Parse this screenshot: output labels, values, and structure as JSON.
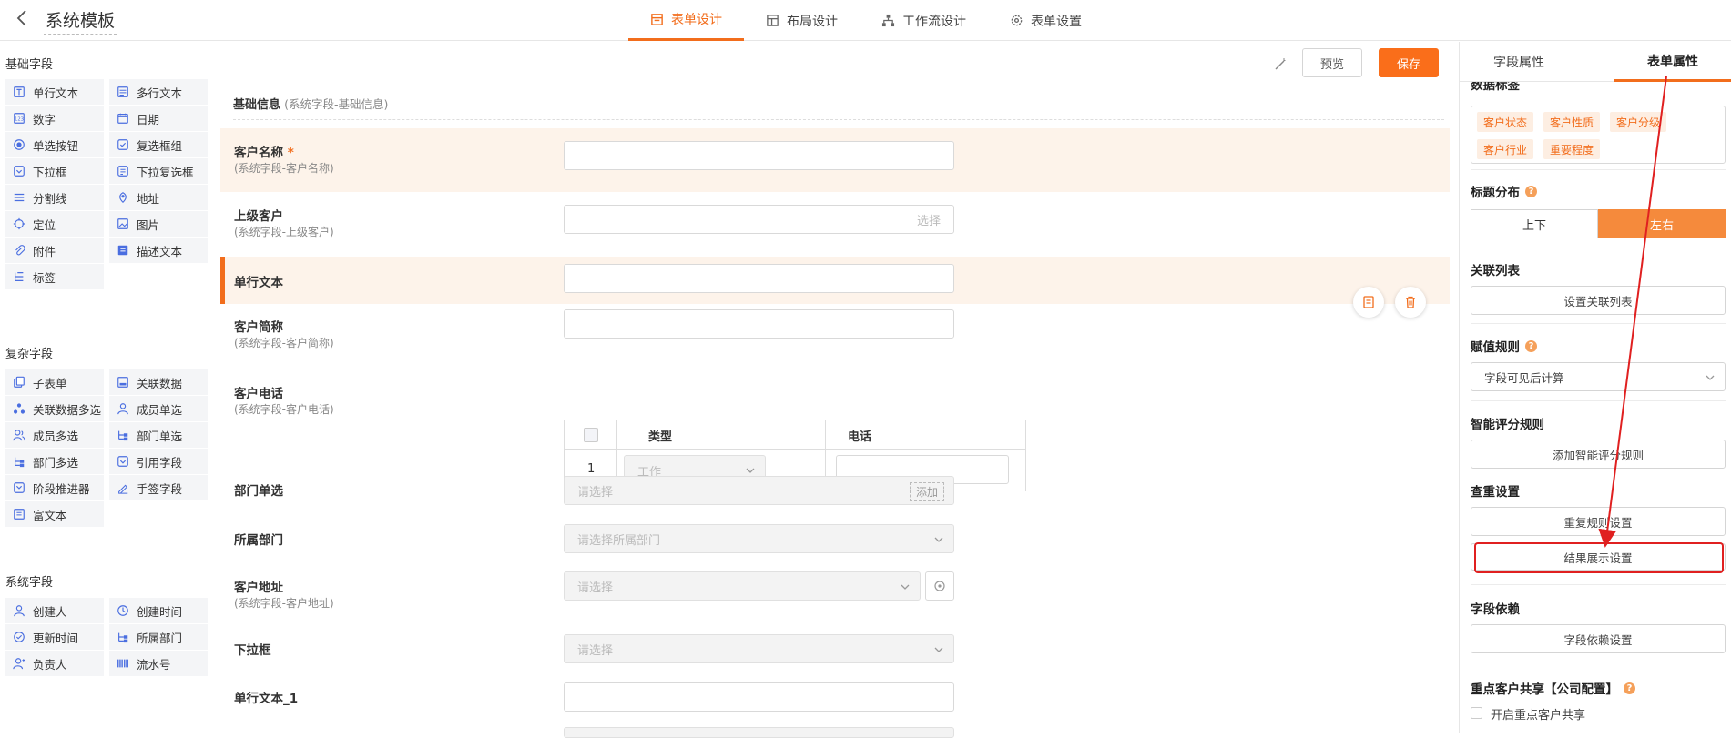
{
  "app": {
    "title": "系统模板"
  },
  "tabs": [
    {
      "label": "表单设计",
      "icon": "form-icon",
      "active": true
    },
    {
      "label": "布局设计",
      "icon": "layout-icon",
      "active": false
    },
    {
      "label": "工作流设计",
      "icon": "workflow-icon",
      "active": false
    },
    {
      "label": "表单设置",
      "icon": "gear-icon",
      "active": false
    }
  ],
  "left": {
    "basic": {
      "title": "基础字段",
      "items": [
        "单行文本",
        "多行文本",
        "数字",
        "日期",
        "单选按钮",
        "复选框组",
        "下拉框",
        "下拉复选框",
        "分割线",
        "地址",
        "定位",
        "图片",
        "附件",
        "描述文本",
        "标签"
      ]
    },
    "complex": {
      "title": "复杂字段",
      "items": [
        "子表单",
        "关联数据",
        "关联数据多选",
        "成员单选",
        "成员多选",
        "部门单选",
        "部门多选",
        "引用字段",
        "阶段推进器",
        "手签字段",
        "富文本"
      ]
    },
    "system": {
      "title": "系统字段",
      "items": [
        "创建人",
        "创建时间",
        "更新时间",
        "所属部门",
        "负责人",
        "流水号"
      ]
    }
  },
  "toolbar": {
    "preview_label": "预览",
    "save_label": "保存"
  },
  "form": {
    "section_title": "基础信息",
    "section_sub": "(系统字段-基础信息)",
    "fields": {
      "customer_name": {
        "label": "客户名称",
        "required_mark": "*",
        "sub": "(系统字段-客户名称)"
      },
      "parent_customer": {
        "label": "上级客户",
        "sub": "(系统字段-上级客户)",
        "placeholder": "选择"
      },
      "single_text": {
        "label": "单行文本"
      },
      "short_name": {
        "label": "客户简称",
        "sub": "(系统字段-客户简称)"
      },
      "phone": {
        "label": "客户电话",
        "sub": "(系统字段-客户电话)",
        "col_type": "类型",
        "col_phone": "电话",
        "row_index": "1",
        "type_value": "工作"
      },
      "dept_single": {
        "label": "部门单选",
        "placeholder": "请选择",
        "add_label": "添加"
      },
      "own_dept": {
        "label": "所属部门",
        "placeholder": "请选择所属部门"
      },
      "address": {
        "label": "客户地址",
        "sub": "(系统字段-客户地址)",
        "placeholder": "请选择"
      },
      "dropdown": {
        "label": "下拉框",
        "placeholder": "请选择"
      },
      "single_text_1": {
        "label": "单行文本_1"
      }
    }
  },
  "right": {
    "tabs": {
      "field_props": "字段属性",
      "form_props": "表单属性"
    },
    "data_tags": {
      "cut_title": "数据标签",
      "tags": [
        "客户状态",
        "客户性质",
        "客户分级",
        "客户行业",
        "重要程度"
      ]
    },
    "title_layout": {
      "label": "标题分布",
      "options": [
        "上下",
        "左右"
      ],
      "selected": "左右"
    },
    "related_list": {
      "label": "关联列表",
      "button": "设置关联列表"
    },
    "assign_rule": {
      "label": "赋值规则",
      "value": "字段可见后计算"
    },
    "smart_score": {
      "label": "智能评分规则",
      "button": "添加智能评分规则"
    },
    "dedup": {
      "label": "查重设置",
      "rule_button": "重复规则设置",
      "result_button": "结果展示设置"
    },
    "dependency": {
      "label": "字段依赖",
      "button": "字段依赖设置"
    },
    "key_share": {
      "label": "重点客户共享【公司配置】",
      "checkbox_label": "开启重点客户共享"
    }
  },
  "colors": {
    "accent": "#f26d1c",
    "annotation": "#e02020"
  }
}
